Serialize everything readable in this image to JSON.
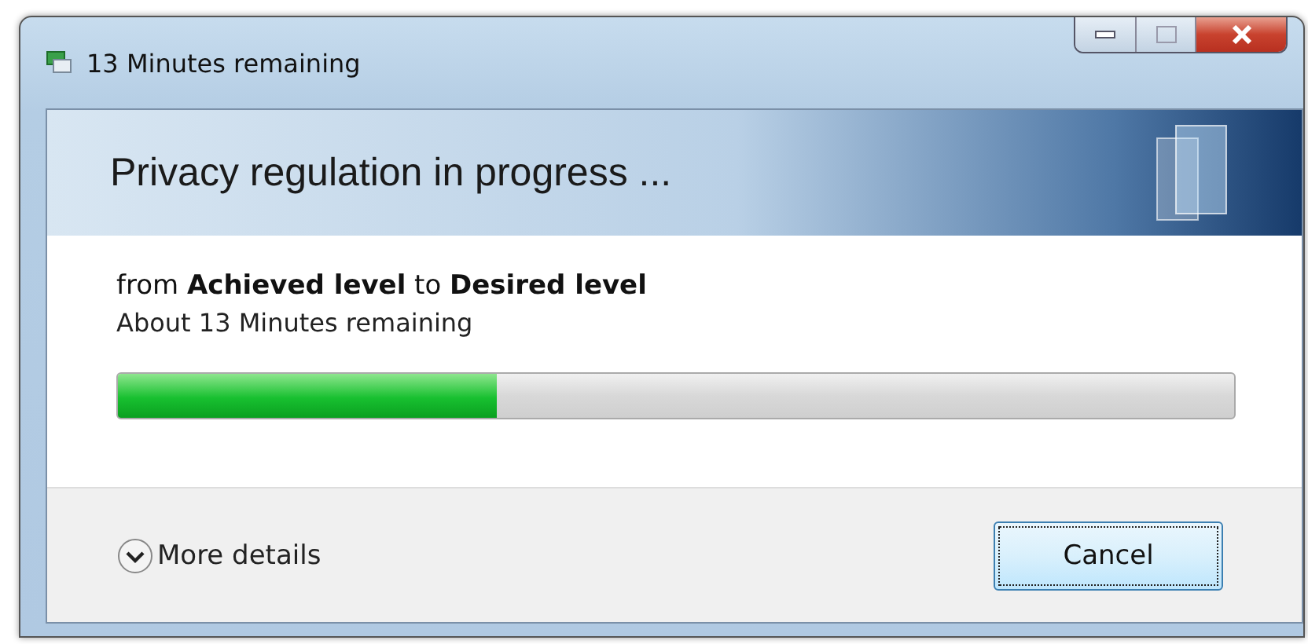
{
  "window": {
    "title": "13 Minutes remaining"
  },
  "header": "Privacy regulation in progress ...",
  "description": "from **Achieved level** to **Desired level**",
  "time_remaining": "About 13 Minutes remaining",
  "progress": {
    "level": 0.34
  },
  "details_toggle": {
    "label": "More details",
    "expanded": false
  },
  "buttons": [
    "Cancel"
  ]
}
